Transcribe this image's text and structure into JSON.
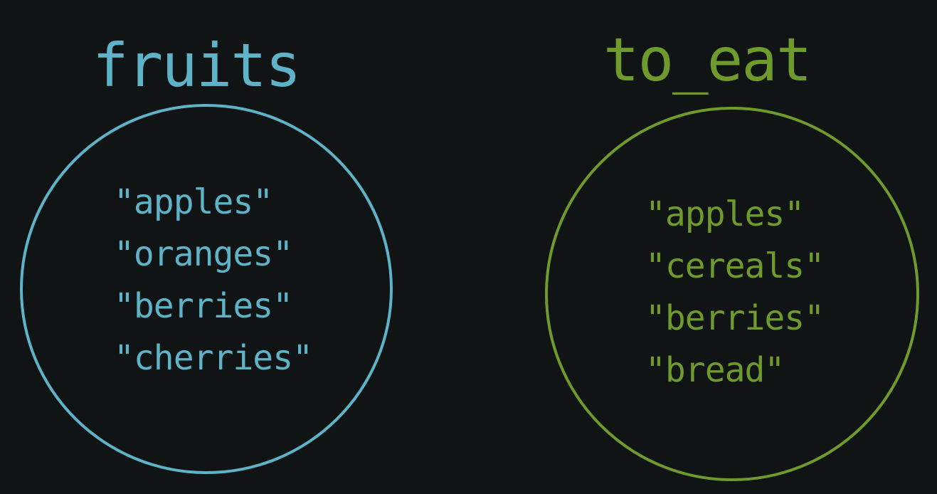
{
  "colors": {
    "background": "#111414",
    "set_a": "#5fb3c9",
    "set_b": "#6f9a2c"
  },
  "sets": [
    {
      "title": "fruits",
      "items": [
        "\"apples\"",
        "\"oranges\"",
        "\"berries\"",
        "\"cherries\""
      ]
    },
    {
      "title": "to_eat",
      "items": [
        "\"apples\"",
        "\"cereals\"",
        "\"berries\"",
        "\"bread\""
      ]
    }
  ]
}
